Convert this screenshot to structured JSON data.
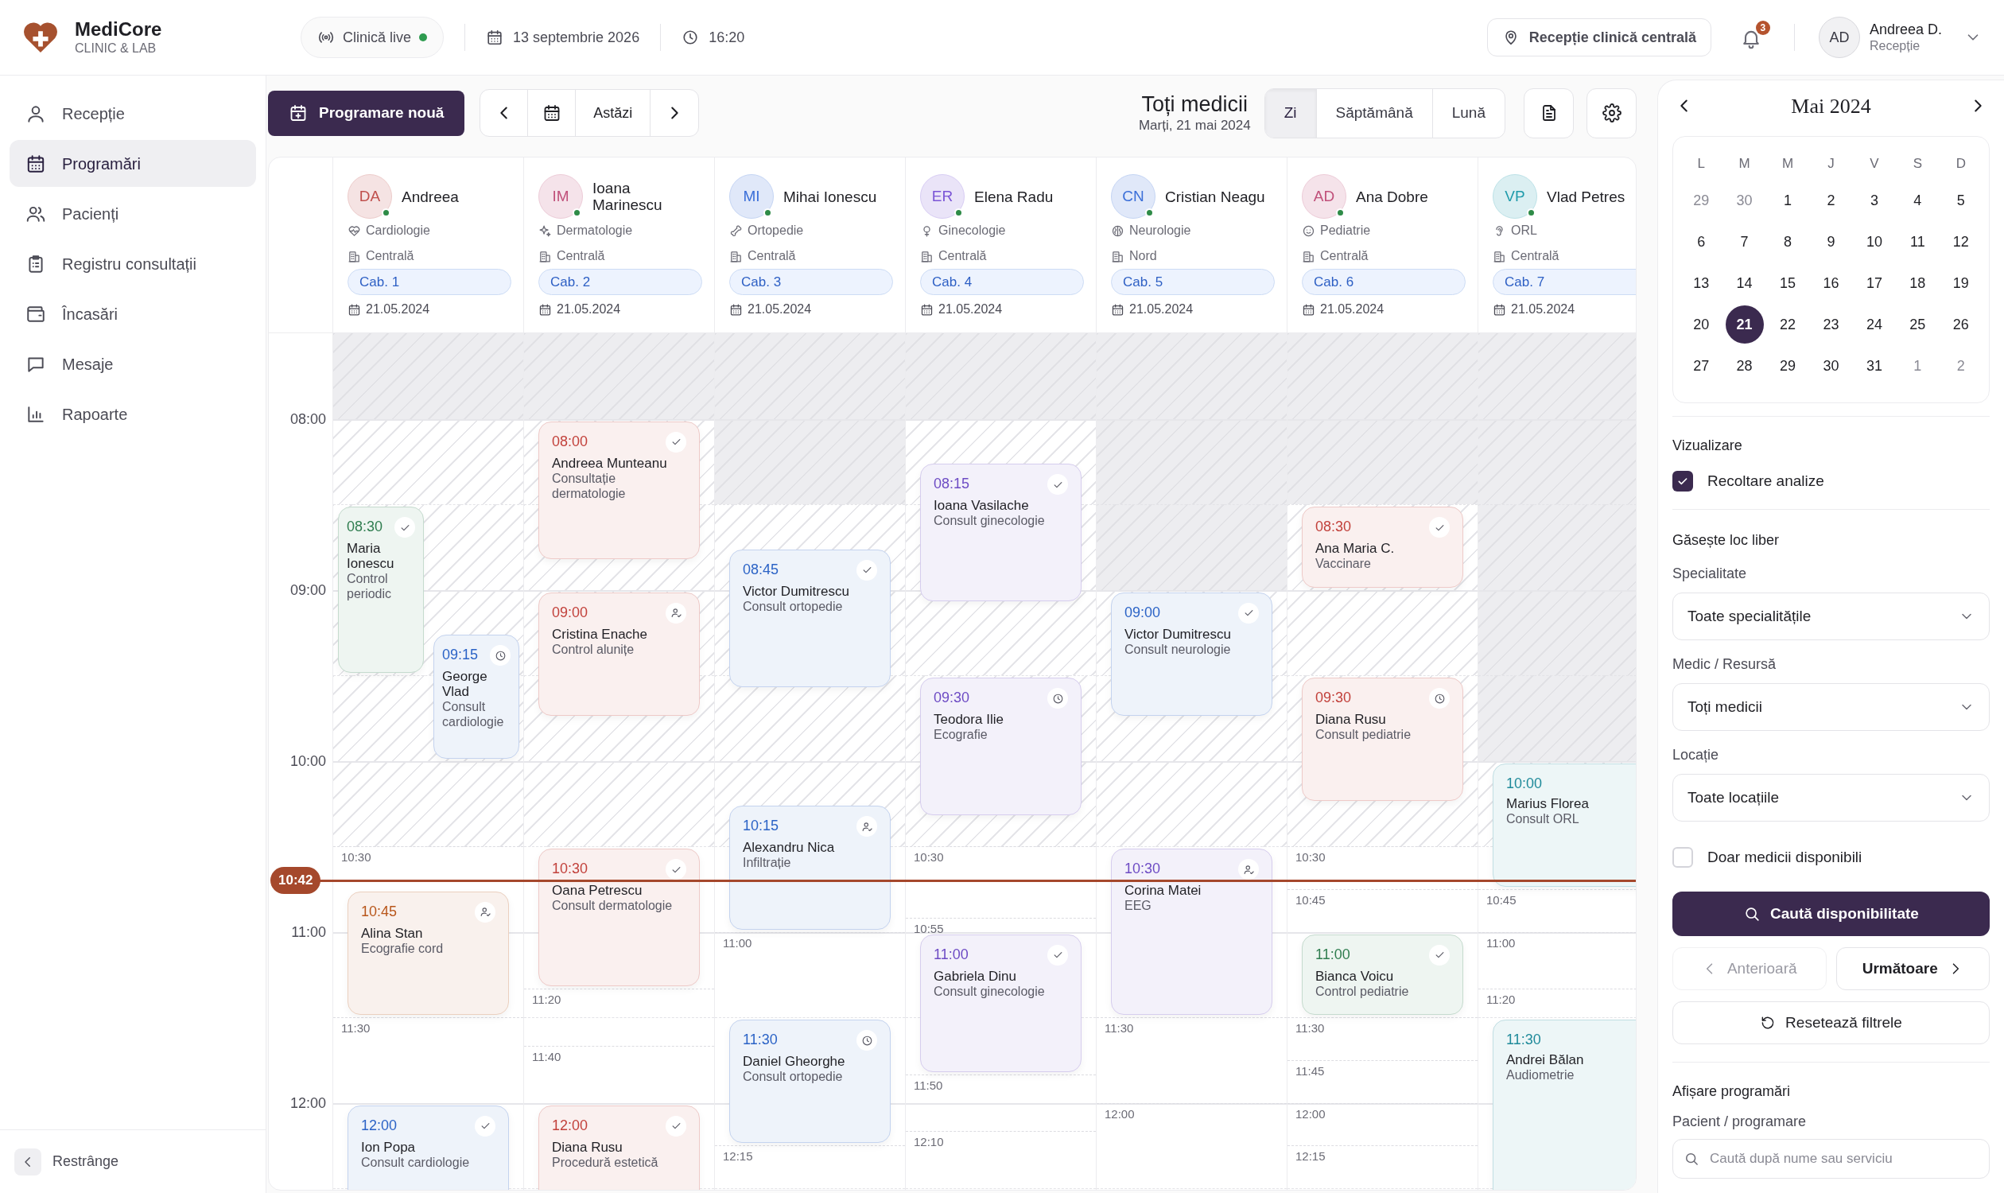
{
  "app": {
    "name": "MediCore",
    "tagline": "CLINIC & LAB"
  },
  "topbar": {
    "live": {
      "label": "Clinică live",
      "on": true
    },
    "date": "13 septembrie 2026",
    "time": "16:20",
    "location": "Recepție clinică centrală",
    "notifications": "3",
    "user": {
      "initials": "AD",
      "name": "Andreea D.",
      "role": "Recepție"
    }
  },
  "sidebar": {
    "items": [
      {
        "label": "Recepție",
        "selected": false
      },
      {
        "label": "Programări",
        "selected": true
      },
      {
        "label": "Pacienți",
        "selected": false
      },
      {
        "label": "Registru consultații",
        "selected": false
      },
      {
        "label": "Încasări",
        "selected": false
      },
      {
        "label": "Mesaje",
        "selected": false
      },
      {
        "label": "Rapoarte",
        "selected": false
      }
    ],
    "collapse": "Restrânge"
  },
  "toolbar": {
    "new_button": "Programare nouă",
    "today": "Astăzi",
    "title": "Toți medicii",
    "subtitle": "Marți, 21 mai 2024",
    "views": [
      {
        "label": "Zi",
        "selected": true
      },
      {
        "label": "Săptămână",
        "selected": false
      },
      {
        "label": "Lună",
        "selected": false
      }
    ]
  },
  "schedule": {
    "hours": [
      "08:00",
      "09:00",
      "10:00",
      "11:00",
      "12:00"
    ],
    "now": "10:42",
    "doctors": [
      {
        "initials": "DA",
        "name": "Andreea",
        "color": "#c0504d",
        "online": true,
        "specialty": "Cardiologie",
        "location": "Centrală",
        "room": "Cab. 1",
        "date": "21.05.2024",
        "availability": [
          {
            "kind": "closed"
          },
          {
            "kind": "hatched"
          },
          {
            "kind": "hatched"
          },
          {
            "kind": "hatched"
          },
          {
            "kind": "hatched"
          },
          {
            "kind": "hatched"
          },
          {
            "kind": "open"
          },
          {
            "kind": "open"
          },
          {
            "kind": "open"
          },
          {
            "kind": "open"
          }
        ],
        "slots": [
          "10:30",
          "11:30"
        ],
        "appointments": [
          {
            "time": "08:30",
            "patient": "Maria Ionescu",
            "service": "Control periodic",
            "color": "#2f7d4f",
            "kind": "confirmed",
            "narrow": true,
            "shifted": false,
            "duration": {
              "kind": "hour"
            }
          },
          {
            "time": "09:15",
            "patient": "George Vlad",
            "service": "Consult cardiologie",
            "color": "#2b63c6",
            "kind": "pending",
            "narrow": true,
            "shifted": true,
            "duration": {
              "kind": "medium"
            }
          },
          {
            "time": "10:45",
            "patient": "Alina Stan",
            "service": "Ecografie cord",
            "color": "#b8561a",
            "kind": "arrived",
            "narrow": false,
            "shifted": false,
            "duration": {
              "kind": "medium"
            }
          },
          {
            "time": "12:00",
            "patient": "Ion Popa",
            "service": "Consult cardiologie",
            "color": "#2b63c6",
            "kind": "confirmed",
            "narrow": false,
            "shifted": false,
            "duration": {
              "kind": "extended"
            }
          }
        ]
      },
      {
        "initials": "IM",
        "name": "Ioana Marinescu",
        "color": "#c0507a",
        "online": true,
        "specialty": "Dermatologie",
        "location": "Centrală",
        "room": "Cab. 2",
        "date": "21.05.2024",
        "availability": [
          {
            "kind": "closed"
          },
          {
            "kind": "hatched"
          },
          {
            "kind": "hatched"
          },
          {
            "kind": "hatched"
          },
          {
            "kind": "hatched"
          },
          {
            "kind": "hatched"
          },
          {
            "kind": "open"
          },
          {
            "kind": "open"
          },
          {
            "kind": "open"
          },
          {
            "kind": "open"
          }
        ],
        "slots": [
          "11:20",
          "11:40"
        ],
        "appointments": [
          {
            "time": "08:00",
            "patient": "Andreea Munteanu",
            "service": "Consultație dermatologie",
            "color": "#c2413b",
            "kind": "confirmed",
            "narrow": false,
            "shifted": false,
            "duration": {
              "kind": "long"
            }
          },
          {
            "time": "09:00",
            "patient": "Cristina Enache",
            "service": "Control alunițe",
            "color": "#c2413b",
            "kind": "arrived",
            "narrow": false,
            "shifted": false,
            "duration": {
              "kind": "medium"
            }
          },
          {
            "time": "10:30",
            "patient": "Oana Petrescu",
            "service": "Consult dermatologie",
            "color": "#c2413b",
            "kind": "confirmed",
            "narrow": false,
            "shifted": false,
            "duration": {
              "kind": "long"
            }
          },
          {
            "time": "12:00",
            "patient": "Diana Rusu",
            "service": "Procedură estetică",
            "color": "#c2413b",
            "kind": "confirmed",
            "narrow": false,
            "shifted": false,
            "duration": {
              "kind": "extended"
            }
          }
        ]
      },
      {
        "initials": "MI",
        "name": "Mihai Ionescu",
        "color": "#3b6fd8",
        "online": true,
        "specialty": "Ortopedie",
        "location": "Centrală",
        "room": "Cab. 3",
        "date": "21.05.2024",
        "availability": [
          {
            "kind": "closed"
          },
          {
            "kind": "closed"
          },
          {
            "kind": "hatched"
          },
          {
            "kind": "hatched"
          },
          {
            "kind": "hatched"
          },
          {
            "kind": "hatched"
          },
          {
            "kind": "open"
          },
          {
            "kind": "open"
          },
          {
            "kind": "open"
          },
          {
            "kind": "open"
          }
        ],
        "slots": [
          "11:00",
          "12:15"
        ],
        "appointments": [
          {
            "time": "08:45",
            "patient": "Victor Dumitrescu",
            "service": "Consult ortopedie",
            "color": "#2b63c6",
            "kind": "confirmed",
            "narrow": false,
            "shifted": false,
            "duration": {
              "kind": "long"
            }
          },
          {
            "time": "10:15",
            "patient": "Alexandru Nica",
            "service": "Infiltrație",
            "color": "#2b63c6",
            "kind": "arrived",
            "narrow": false,
            "shifted": false,
            "duration": {
              "kind": "medium"
            }
          },
          {
            "time": "11:30",
            "patient": "Daniel Gheorghe",
            "service": "Consult ortopedie",
            "color": "#2b63c6",
            "kind": "pending",
            "narrow": false,
            "shifted": false,
            "duration": {
              "kind": "medium"
            }
          }
        ]
      },
      {
        "initials": "ER",
        "name": "Elena Radu",
        "color": "#7b55d6",
        "online": true,
        "specialty": "Ginecologie",
        "location": "Centrală",
        "room": "Cab. 4",
        "date": "21.05.2024",
        "availability": [
          {
            "kind": "closed"
          },
          {
            "kind": "hatched"
          },
          {
            "kind": "hatched"
          },
          {
            "kind": "hatched"
          },
          {
            "kind": "hatched"
          },
          {
            "kind": "hatched"
          },
          {
            "kind": "open"
          },
          {
            "kind": "open"
          },
          {
            "kind": "open"
          },
          {
            "kind": "open"
          }
        ],
        "slots": [
          "10:30",
          "10:55",
          "11:50",
          "12:10"
        ],
        "appointments": [
          {
            "time": "08:15",
            "patient": "Ioana Vasilache",
            "service": "Consult ginecologie",
            "color": "#6d4bc4",
            "kind": "confirmed",
            "narrow": false,
            "shifted": false,
            "duration": {
              "kind": "long"
            }
          },
          {
            "time": "09:30",
            "patient": "Teodora Ilie",
            "service": "Ecografie",
            "color": "#6d4bc4",
            "kind": "pending",
            "narrow": false,
            "shifted": false,
            "duration": {
              "kind": "long"
            }
          },
          {
            "time": "11:00",
            "patient": "Gabriela Dinu",
            "service": "Consult ginecologie",
            "color": "#6d4bc4",
            "kind": "confirmed",
            "narrow": false,
            "shifted": false,
            "duration": {
              "kind": "long"
            }
          }
        ]
      },
      {
        "initials": "CN",
        "name": "Cristian Neagu",
        "color": "#3b6fd8",
        "online": true,
        "specialty": "Neurologie",
        "location": "Nord",
        "room": "Cab. 5",
        "date": "21.05.2024",
        "availability": [
          {
            "kind": "closed"
          },
          {
            "kind": "closed"
          },
          {
            "kind": "closed"
          },
          {
            "kind": "hatched"
          },
          {
            "kind": "hatched"
          },
          {
            "kind": "hatched"
          },
          {
            "kind": "open"
          },
          {
            "kind": "open"
          },
          {
            "kind": "open"
          },
          {
            "kind": "open"
          }
        ],
        "slots": [
          "11:30",
          "12:00"
        ],
        "appointments": [
          {
            "time": "09:00",
            "patient": "Victor Dumitrescu",
            "service": "Consult neurologie",
            "color": "#2b63c6",
            "kind": "confirmed",
            "narrow": false,
            "shifted": false,
            "duration": {
              "kind": "medium"
            }
          },
          {
            "time": "10:30",
            "patient": "Corina Matei",
            "service": "EEG",
            "color": "#6d4bc4",
            "kind": "arrived",
            "narrow": false,
            "shifted": false,
            "duration": {
              "kind": "hour"
            }
          }
        ]
      },
      {
        "initials": "AD",
        "name": "Ana Dobre",
        "color": "#c0507a",
        "online": true,
        "specialty": "Pediatrie",
        "location": "Centrală",
        "room": "Cab. 6",
        "date": "21.05.2024",
        "availability": [
          {
            "kind": "closed"
          },
          {
            "kind": "closed"
          },
          {
            "kind": "hatched"
          },
          {
            "kind": "hatched"
          },
          {
            "kind": "hatched"
          },
          {
            "kind": "hatched"
          },
          {
            "kind": "open"
          },
          {
            "kind": "open"
          },
          {
            "kind": "open"
          },
          {
            "kind": "open"
          }
        ],
        "slots": [
          "10:30",
          "10:45",
          "11:30",
          "11:45",
          "12:00",
          "12:15"
        ],
        "appointments": [
          {
            "time": "08:30",
            "patient": "Ana Maria C.",
            "service": "Vaccinare",
            "color": "#c2413b",
            "kind": "confirmed",
            "narrow": false,
            "shifted": false,
            "duration": {
              "kind": "short"
            }
          },
          {
            "time": "09:30",
            "patient": "Diana Rusu",
            "service": "Consult pediatrie",
            "color": "#c2413b",
            "kind": "pending",
            "narrow": false,
            "shifted": false,
            "duration": {
              "kind": "medium"
            }
          },
          {
            "time": "11:00",
            "patient": "Bianca Voicu",
            "service": "Control pediatrie",
            "color": "#2f7d4f",
            "kind": "confirmed",
            "narrow": false,
            "shifted": false,
            "duration": {
              "kind": "short"
            }
          }
        ]
      },
      {
        "initials": "VP",
        "name": "Vlad Petres",
        "color": "#1f9bab",
        "online": true,
        "specialty": "ORL",
        "location": "Centrală",
        "room": "Cab. 7",
        "date": "21.05.2024",
        "availability": [
          {
            "kind": "closed"
          },
          {
            "kind": "closed"
          },
          {
            "kind": "closed"
          },
          {
            "kind": "closed"
          },
          {
            "kind": "closed"
          },
          {
            "kind": "hatched"
          },
          {
            "kind": "open"
          },
          {
            "kind": "open"
          },
          {
            "kind": "open"
          },
          {
            "kind": "open"
          }
        ],
        "slots": [
          "10:45",
          "11:00",
          "11:20"
        ],
        "appointments": [
          {
            "time": "10:00",
            "patient": "Marius Florea",
            "service": "Consult ORL",
            "color": "#1f8a9a",
            "kind": "plain",
            "narrow": false,
            "shifted": false,
            "duration": {
              "kind": "medium"
            }
          },
          {
            "time": "11:30",
            "patient": "Andrei Bălan",
            "service": "Audiometrie",
            "color": "#1f8a9a",
            "kind": "plain",
            "narrow": false,
            "shifted": false,
            "duration": {
              "kind": "extended"
            }
          }
        ]
      }
    ]
  },
  "side_panel": {
    "calendar": {
      "month": "Mai 2024",
      "weekdays": [
        "L",
        "M",
        "M",
        "J",
        "V",
        "S",
        "D"
      ],
      "days": [
        {
          "label": "29",
          "muted": true,
          "selected": false
        },
        {
          "label": "30",
          "muted": true,
          "selected": false
        },
        {
          "label": "1",
          "muted": false,
          "selected": false
        },
        {
          "label": "2",
          "muted": false,
          "selected": false
        },
        {
          "label": "3",
          "muted": false,
          "selected": false
        },
        {
          "label": "4",
          "muted": false,
          "selected": false
        },
        {
          "label": "5",
          "muted": false,
          "selected": false
        },
        {
          "label": "6",
          "muted": false,
          "selected": false
        },
        {
          "label": "7",
          "muted": false,
          "selected": false
        },
        {
          "label": "8",
          "muted": false,
          "selected": false
        },
        {
          "label": "9",
          "muted": false,
          "selected": false
        },
        {
          "label": "10",
          "muted": false,
          "selected": false
        },
        {
          "label": "11",
          "muted": false,
          "selected": false
        },
        {
          "label": "12",
          "muted": false,
          "selected": false
        },
        {
          "label": "13",
          "muted": false,
          "selected": false
        },
        {
          "label": "14",
          "muted": false,
          "selected": false
        },
        {
          "label": "15",
          "muted": false,
          "selected": false
        },
        {
          "label": "16",
          "muted": false,
          "selected": false
        },
        {
          "label": "17",
          "muted": false,
          "selected": false
        },
        {
          "label": "18",
          "muted": false,
          "selected": false
        },
        {
          "label": "19",
          "muted": false,
          "selected": false
        },
        {
          "label": "20",
          "muted": false,
          "selected": false
        },
        {
          "label": "21",
          "muted": false,
          "selected": true
        },
        {
          "label": "22",
          "muted": false,
          "selected": false
        },
        {
          "label": "23",
          "muted": false,
          "selected": false
        },
        {
          "label": "24",
          "muted": false,
          "selected": false
        },
        {
          "label": "25",
          "muted": false,
          "selected": false
        },
        {
          "label": "26",
          "muted": false,
          "selected": false
        },
        {
          "label": "27",
          "muted": false,
          "selected": false
        },
        {
          "label": "28",
          "muted": false,
          "selected": false
        },
        {
          "label": "29",
          "muted": false,
          "selected": false
        },
        {
          "label": "30",
          "muted": false,
          "selected": false
        },
        {
          "label": "31",
          "muted": false,
          "selected": false
        },
        {
          "label": "1",
          "muted": true,
          "selected": false
        },
        {
          "label": "2",
          "muted": true,
          "selected": false
        }
      ]
    },
    "view_section": {
      "title": "Vizualizare",
      "options": [
        {
          "label": "Recoltare analize",
          "checked": true
        }
      ]
    },
    "finder": {
      "title": "Găsește loc liber",
      "filters": [
        {
          "label": "Specialitate",
          "value": "Toate specialitățile"
        },
        {
          "label": "Medic / Resursă",
          "value": "Toți medicii"
        },
        {
          "label": "Locație",
          "value": "Toate locațiile"
        }
      ],
      "only_available": {
        "label": "Doar medicii disponibili",
        "checked": false
      },
      "search_button": "Caută disponibilitate",
      "prev": {
        "label": "Anterioară",
        "disabled": true
      },
      "next": {
        "label": "Următoare",
        "disabled": false
      },
      "reset": "Resetează filtrele"
    },
    "appointments_section": {
      "title": "Afișare programări",
      "field_label": "Pacient / programare",
      "placeholder": "Caută după nume sau serviciu"
    }
  }
}
